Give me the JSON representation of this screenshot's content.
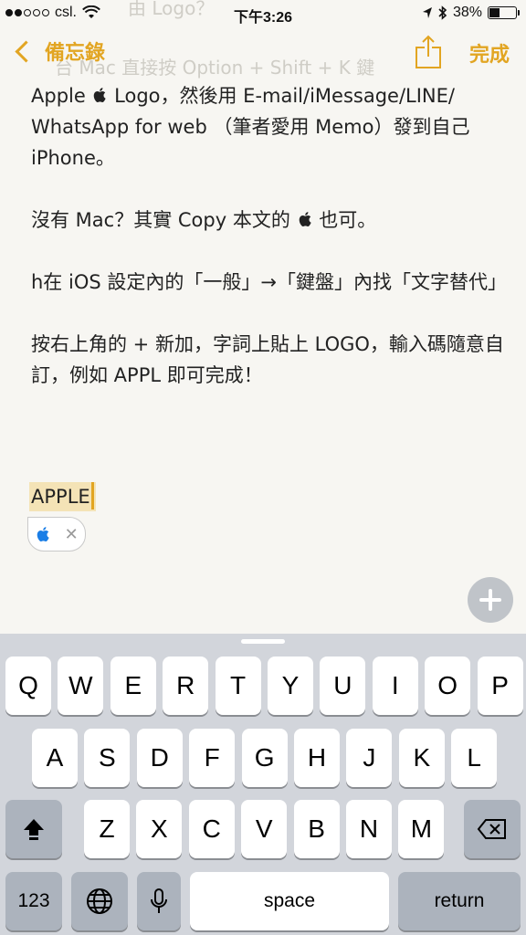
{
  "status": {
    "carrier": "csl.",
    "time": "下午3:26",
    "battery": "38%"
  },
  "ghost": {
    "line1": "由 Logo？",
    "line2": "台 Mac 直接按 Option + Shift + K 鍵"
  },
  "nav": {
    "back_label": "備忘錄",
    "done_label": "完成"
  },
  "note": {
    "p1_a": "Apple ",
    "p1_b": " Logo，然後用 E-mail/iMessage/LINE/ WhatsApp for web （筆者愛用 Memo）發到自己 iPhone。",
    "p2_a": "沒有 Mac？其實 Copy 本文的 ",
    "p2_b": " 也可。",
    "p3": "h在 iOS 設定內的「一般」→「鍵盤」內找「文字替代」",
    "p4": "按右上角的 + 新加，字詞上貼上 LOGO，輸入碼隨意自訂，例如 APPL 即可完成！"
  },
  "typed_text": "APPLE",
  "keyboard": {
    "row1": [
      "Q",
      "W",
      "E",
      "R",
      "T",
      "Y",
      "U",
      "I",
      "O",
      "P"
    ],
    "row2": [
      "A",
      "S",
      "D",
      "F",
      "G",
      "H",
      "J",
      "K",
      "L"
    ],
    "row3": [
      "Z",
      "X",
      "C",
      "V",
      "B",
      "N",
      "M"
    ],
    "numbers_label": "123",
    "space_label": "space",
    "return_label": "return"
  },
  "colors": {
    "accent": "#e2a522",
    "background": "#f7f6f2",
    "keyboard_bg": "#d2d5db"
  }
}
